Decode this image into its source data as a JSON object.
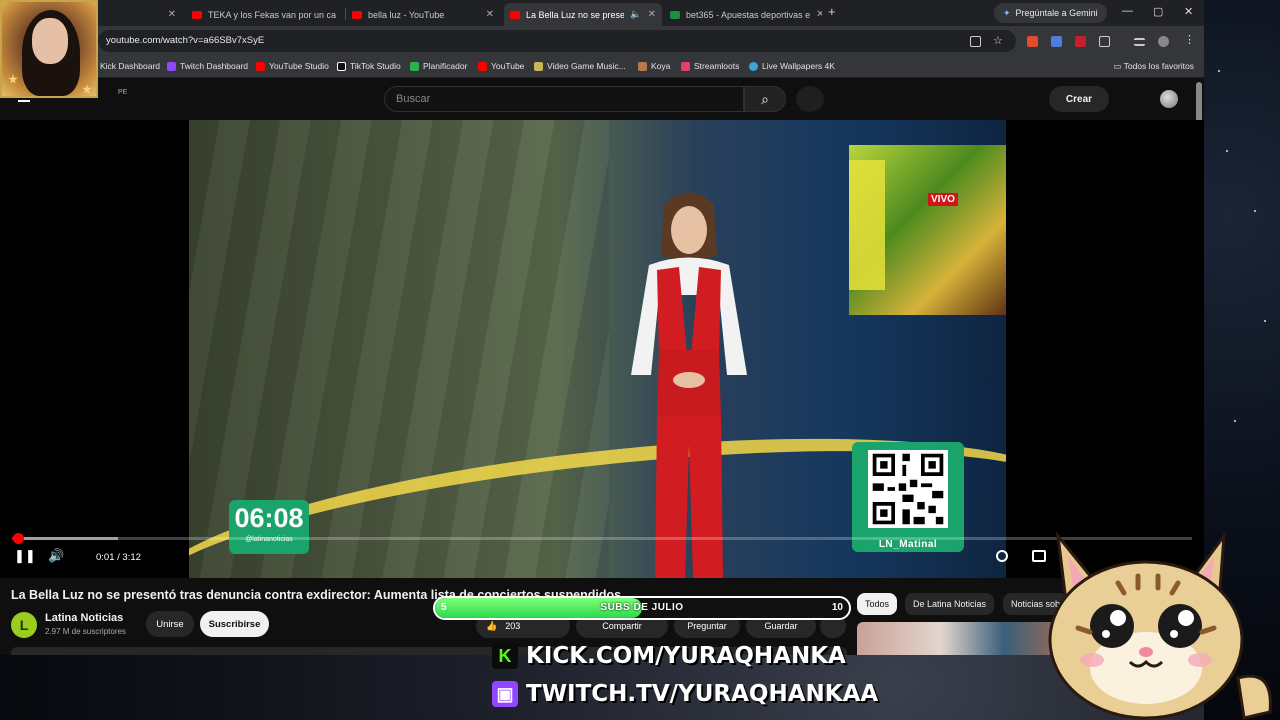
{
  "browser": {
    "tabs": [
      {
        "label": "",
        "active": false
      },
      {
        "label": "TEKA y los Fekas van por un ca",
        "active": false
      },
      {
        "label": "bella luz - YouTube",
        "active": false
      },
      {
        "label": "La Bella Luz no se presentó",
        "active": true
      },
      {
        "label": "bet365 - Apuestas deportivas e",
        "active": false
      }
    ],
    "gemini": "Pregúntale a Gemini",
    "url": "youtube.com/watch?v=a66SBv7xSyE",
    "bookmarks": [
      "Kick Dashboard",
      "Twitch Dashboard",
      "YouTube Studio",
      "TikTok Studio",
      "Planificador",
      "YouTube",
      "Video Game Music...",
      "Koya",
      "Streamloots",
      "Live Wallpapers 4K"
    ],
    "all_favorites": "Todos los favoritos"
  },
  "youtube": {
    "country": "PE",
    "search_placeholder": "Buscar",
    "create": "Crear",
    "video": {
      "vivo": "VIVO",
      "clock": "06:08",
      "handle": "@latinanoticias",
      "qr_label": "LN_Matinal",
      "time": "0:01 / 3:12",
      "progress": 0.005,
      "buffered": 0.09
    },
    "title": "La Bella Luz no se presentó tras denuncia contra exdirector: Aumenta lista de conciertos suspendidos",
    "channel": {
      "name": "Latina Noticias",
      "subs": "2.97 M de suscriptores",
      "logo_letter": "L"
    },
    "join": "Unirse",
    "subscribe": "Suscribirse",
    "actions": {
      "likes": "203",
      "share": "Compartir",
      "ask": "Preguntar",
      "save": "Guardar"
    },
    "chips": [
      "Todos",
      "De Latina Noticias",
      "Noticias sob"
    ]
  },
  "overlay": {
    "subs_goal": {
      "label": "SUBS DE JULIO",
      "min": "5",
      "max": "10",
      "fraction": 0.5
    },
    "kick": "KICK.COM/YURAQHANKA",
    "twitch": "TWITCH.TV/YURAQHANKAA"
  },
  "colors": {
    "youtube_red": "#ff0000",
    "kick_green": "#53fc18",
    "twitch_purple": "#9146ff",
    "latina_green": "#1aa36a"
  }
}
